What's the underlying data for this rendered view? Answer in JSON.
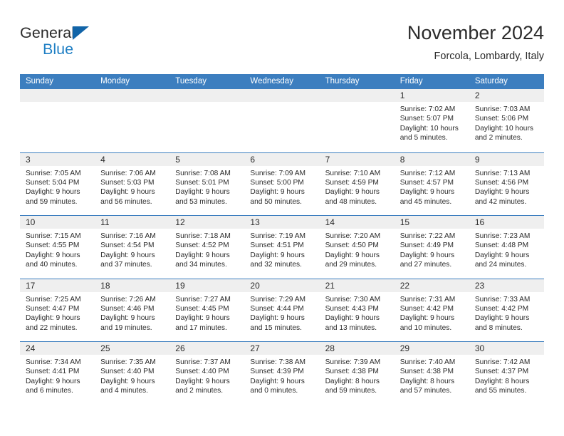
{
  "brand": {
    "name_part1": "General",
    "name_part2": "Blue",
    "triangle_color": "#1164a8",
    "text_color": "#2b2b2b",
    "blue_color": "#1f7fc4"
  },
  "header": {
    "title": "November 2024",
    "subtitle": "Forcola, Lombardy, Italy"
  },
  "theme": {
    "header_bg": "#3c7ebf",
    "daynum_bg": "#efefef",
    "text": "#2b2b2b"
  },
  "weekday_headers": [
    "Sunday",
    "Monday",
    "Tuesday",
    "Wednesday",
    "Thursday",
    "Friday",
    "Saturday"
  ],
  "labels": {
    "sunrise_prefix": "Sunrise: ",
    "sunset_prefix": "Sunset: ",
    "daylight_prefix": "Daylight: "
  },
  "weeks": [
    [
      {
        "day": "",
        "empty": true
      },
      {
        "day": "",
        "empty": true
      },
      {
        "day": "",
        "empty": true
      },
      {
        "day": "",
        "empty": true
      },
      {
        "day": "",
        "empty": true
      },
      {
        "day": "1",
        "sunrise": "Sunrise: 7:02 AM",
        "sunset": "Sunset: 5:07 PM",
        "daylight": "Daylight: 10 hours and 5 minutes."
      },
      {
        "day": "2",
        "sunrise": "Sunrise: 7:03 AM",
        "sunset": "Sunset: 5:06 PM",
        "daylight": "Daylight: 10 hours and 2 minutes."
      }
    ],
    [
      {
        "day": "3",
        "sunrise": "Sunrise: 7:05 AM",
        "sunset": "Sunset: 5:04 PM",
        "daylight": "Daylight: 9 hours and 59 minutes."
      },
      {
        "day": "4",
        "sunrise": "Sunrise: 7:06 AM",
        "sunset": "Sunset: 5:03 PM",
        "daylight": "Daylight: 9 hours and 56 minutes."
      },
      {
        "day": "5",
        "sunrise": "Sunrise: 7:08 AM",
        "sunset": "Sunset: 5:01 PM",
        "daylight": "Daylight: 9 hours and 53 minutes."
      },
      {
        "day": "6",
        "sunrise": "Sunrise: 7:09 AM",
        "sunset": "Sunset: 5:00 PM",
        "daylight": "Daylight: 9 hours and 50 minutes."
      },
      {
        "day": "7",
        "sunrise": "Sunrise: 7:10 AM",
        "sunset": "Sunset: 4:59 PM",
        "daylight": "Daylight: 9 hours and 48 minutes."
      },
      {
        "day": "8",
        "sunrise": "Sunrise: 7:12 AM",
        "sunset": "Sunset: 4:57 PM",
        "daylight": "Daylight: 9 hours and 45 minutes."
      },
      {
        "day": "9",
        "sunrise": "Sunrise: 7:13 AM",
        "sunset": "Sunset: 4:56 PM",
        "daylight": "Daylight: 9 hours and 42 minutes."
      }
    ],
    [
      {
        "day": "10",
        "sunrise": "Sunrise: 7:15 AM",
        "sunset": "Sunset: 4:55 PM",
        "daylight": "Daylight: 9 hours and 40 minutes."
      },
      {
        "day": "11",
        "sunrise": "Sunrise: 7:16 AM",
        "sunset": "Sunset: 4:54 PM",
        "daylight": "Daylight: 9 hours and 37 minutes."
      },
      {
        "day": "12",
        "sunrise": "Sunrise: 7:18 AM",
        "sunset": "Sunset: 4:52 PM",
        "daylight": "Daylight: 9 hours and 34 minutes."
      },
      {
        "day": "13",
        "sunrise": "Sunrise: 7:19 AM",
        "sunset": "Sunset: 4:51 PM",
        "daylight": "Daylight: 9 hours and 32 minutes."
      },
      {
        "day": "14",
        "sunrise": "Sunrise: 7:20 AM",
        "sunset": "Sunset: 4:50 PM",
        "daylight": "Daylight: 9 hours and 29 minutes."
      },
      {
        "day": "15",
        "sunrise": "Sunrise: 7:22 AM",
        "sunset": "Sunset: 4:49 PM",
        "daylight": "Daylight: 9 hours and 27 minutes."
      },
      {
        "day": "16",
        "sunrise": "Sunrise: 7:23 AM",
        "sunset": "Sunset: 4:48 PM",
        "daylight": "Daylight: 9 hours and 24 minutes."
      }
    ],
    [
      {
        "day": "17",
        "sunrise": "Sunrise: 7:25 AM",
        "sunset": "Sunset: 4:47 PM",
        "daylight": "Daylight: 9 hours and 22 minutes."
      },
      {
        "day": "18",
        "sunrise": "Sunrise: 7:26 AM",
        "sunset": "Sunset: 4:46 PM",
        "daylight": "Daylight: 9 hours and 19 minutes."
      },
      {
        "day": "19",
        "sunrise": "Sunrise: 7:27 AM",
        "sunset": "Sunset: 4:45 PM",
        "daylight": "Daylight: 9 hours and 17 minutes."
      },
      {
        "day": "20",
        "sunrise": "Sunrise: 7:29 AM",
        "sunset": "Sunset: 4:44 PM",
        "daylight": "Daylight: 9 hours and 15 minutes."
      },
      {
        "day": "21",
        "sunrise": "Sunrise: 7:30 AM",
        "sunset": "Sunset: 4:43 PM",
        "daylight": "Daylight: 9 hours and 13 minutes."
      },
      {
        "day": "22",
        "sunrise": "Sunrise: 7:31 AM",
        "sunset": "Sunset: 4:42 PM",
        "daylight": "Daylight: 9 hours and 10 minutes."
      },
      {
        "day": "23",
        "sunrise": "Sunrise: 7:33 AM",
        "sunset": "Sunset: 4:42 PM",
        "daylight": "Daylight: 9 hours and 8 minutes."
      }
    ],
    [
      {
        "day": "24",
        "sunrise": "Sunrise: 7:34 AM",
        "sunset": "Sunset: 4:41 PM",
        "daylight": "Daylight: 9 hours and 6 minutes."
      },
      {
        "day": "25",
        "sunrise": "Sunrise: 7:35 AM",
        "sunset": "Sunset: 4:40 PM",
        "daylight": "Daylight: 9 hours and 4 minutes."
      },
      {
        "day": "26",
        "sunrise": "Sunrise: 7:37 AM",
        "sunset": "Sunset: 4:40 PM",
        "daylight": "Daylight: 9 hours and 2 minutes."
      },
      {
        "day": "27",
        "sunrise": "Sunrise: 7:38 AM",
        "sunset": "Sunset: 4:39 PM",
        "daylight": "Daylight: 9 hours and 0 minutes."
      },
      {
        "day": "28",
        "sunrise": "Sunrise: 7:39 AM",
        "sunset": "Sunset: 4:38 PM",
        "daylight": "Daylight: 8 hours and 59 minutes."
      },
      {
        "day": "29",
        "sunrise": "Sunrise: 7:40 AM",
        "sunset": "Sunset: 4:38 PM",
        "daylight": "Daylight: 8 hours and 57 minutes."
      },
      {
        "day": "30",
        "sunrise": "Sunrise: 7:42 AM",
        "sunset": "Sunset: 4:37 PM",
        "daylight": "Daylight: 8 hours and 55 minutes."
      }
    ]
  ]
}
